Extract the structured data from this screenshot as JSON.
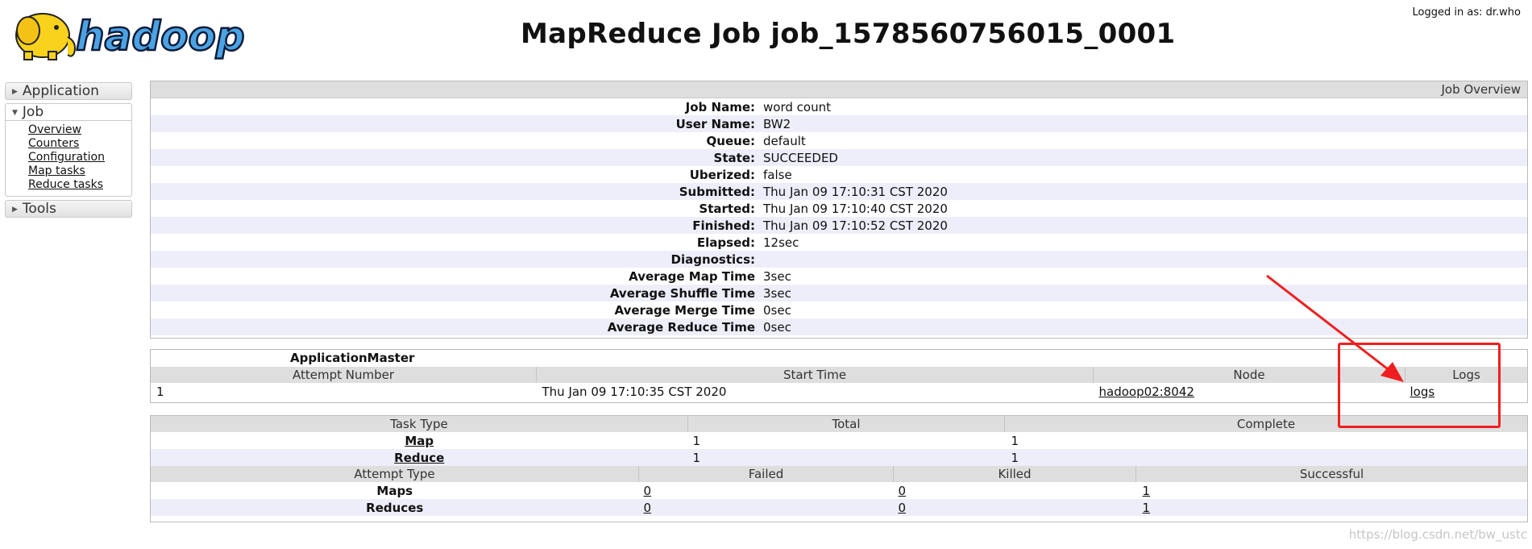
{
  "header": {
    "logo_text": "hadoop",
    "title": "MapReduce Job job_1578560756015_0001",
    "logged_in": "Logged in as: dr.who"
  },
  "sidebar": {
    "sections": [
      {
        "label": "Application"
      },
      {
        "label": "Job",
        "items": [
          "Overview",
          "Counters",
          "Configuration",
          "Map tasks",
          "Reduce tasks"
        ]
      },
      {
        "label": "Tools"
      }
    ]
  },
  "overview": {
    "heading": "Job Overview",
    "rows": [
      {
        "key": "Job Name:",
        "value": "word count"
      },
      {
        "key": "User Name:",
        "value": "BW2"
      },
      {
        "key": "Queue:",
        "value": "default"
      },
      {
        "key": "State:",
        "value": "SUCCEEDED"
      },
      {
        "key": "Uberized:",
        "value": "false"
      },
      {
        "key": "Submitted:",
        "value": "Thu Jan 09 17:10:31 CST 2020"
      },
      {
        "key": "Started:",
        "value": "Thu Jan 09 17:10:40 CST 2020"
      },
      {
        "key": "Finished:",
        "value": "Thu Jan 09 17:10:52 CST 2020"
      },
      {
        "key": "Elapsed:",
        "value": "12sec"
      },
      {
        "key": "Diagnostics:",
        "value": ""
      },
      {
        "key": "Average Map Time",
        "value": "3sec"
      },
      {
        "key": "Average Shuffle Time",
        "value": "3sec"
      },
      {
        "key": "Average Merge Time",
        "value": "0sec"
      },
      {
        "key": "Average Reduce Time",
        "value": "0sec"
      }
    ]
  },
  "app_master": {
    "title": "ApplicationMaster",
    "columns": [
      "Attempt Number",
      "Start Time",
      "Node",
      "Logs"
    ],
    "row": {
      "attempt": "1",
      "start": "Thu Jan 09 17:10:35 CST 2020",
      "node": "hadoop02:8042",
      "logs": "logs"
    }
  },
  "tasks": {
    "columns": [
      "Task Type",
      "Total",
      "Complete"
    ],
    "rows": [
      {
        "type": "Map",
        "total": "1",
        "complete": "1"
      },
      {
        "type": "Reduce",
        "total": "1",
        "complete": "1"
      }
    ],
    "attempt_columns": [
      "Attempt Type",
      "Failed",
      "Killed",
      "Successful"
    ],
    "attempt_rows": [
      {
        "type": "Maps",
        "failed": "0",
        "killed": "0",
        "successful": "1"
      },
      {
        "type": "Reduces",
        "failed": "0",
        "killed": "0",
        "successful": "1"
      }
    ]
  },
  "annotation": {
    "color": "#f01f1f"
  },
  "watermark": "https://blog.csdn.net/bw_ustc"
}
